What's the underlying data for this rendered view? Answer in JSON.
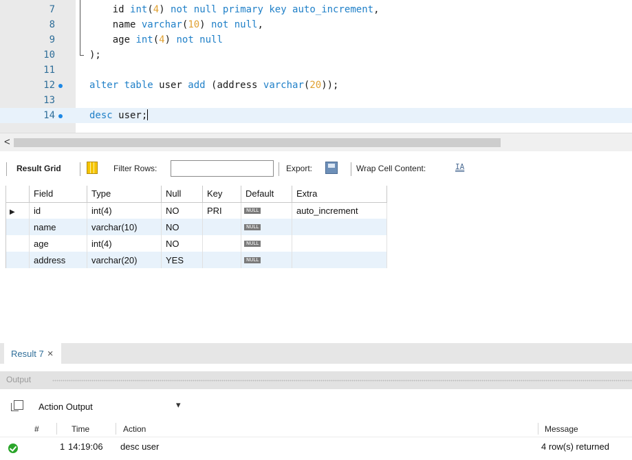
{
  "editor": {
    "lines": [
      {
        "num": "7",
        "marker": false,
        "current": false,
        "tokens": [
          {
            "t": "    id ",
            "c": ""
          },
          {
            "t": "int",
            "c": "kw"
          },
          {
            "t": "(",
            "c": ""
          },
          {
            "t": "4",
            "c": "nm"
          },
          {
            "t": ") ",
            "c": ""
          },
          {
            "t": "not null primary key auto_increment",
            "c": "kw"
          },
          {
            "t": ",",
            "c": ""
          }
        ]
      },
      {
        "num": "8",
        "marker": false,
        "current": false,
        "tokens": [
          {
            "t": "    name ",
            "c": ""
          },
          {
            "t": "varchar",
            "c": "kw"
          },
          {
            "t": "(",
            "c": ""
          },
          {
            "t": "10",
            "c": "nm"
          },
          {
            "t": ") ",
            "c": ""
          },
          {
            "t": "not null",
            "c": "kw"
          },
          {
            "t": ",",
            "c": ""
          }
        ]
      },
      {
        "num": "9",
        "marker": false,
        "current": false,
        "tokens": [
          {
            "t": "    age ",
            "c": ""
          },
          {
            "t": "int",
            "c": "kw"
          },
          {
            "t": "(",
            "c": ""
          },
          {
            "t": "4",
            "c": "nm"
          },
          {
            "t": ") ",
            "c": ""
          },
          {
            "t": "not null",
            "c": "kw"
          }
        ]
      },
      {
        "num": "10",
        "marker": false,
        "current": false,
        "tokens": [
          {
            "t": ");",
            "c": ""
          }
        ]
      },
      {
        "num": "11",
        "marker": false,
        "current": false,
        "tokens": []
      },
      {
        "num": "12",
        "marker": true,
        "current": false,
        "tokens": [
          {
            "t": "alter table",
            "c": "kw"
          },
          {
            "t": " user ",
            "c": ""
          },
          {
            "t": "add",
            "c": "kw"
          },
          {
            "t": " (address ",
            "c": ""
          },
          {
            "t": "varchar",
            "c": "kw"
          },
          {
            "t": "(",
            "c": ""
          },
          {
            "t": "20",
            "c": "nm"
          },
          {
            "t": "));",
            "c": ""
          }
        ]
      },
      {
        "num": "13",
        "marker": false,
        "current": false,
        "tokens": []
      },
      {
        "num": "14",
        "marker": true,
        "current": true,
        "tokens": [
          {
            "t": "desc",
            "c": "kw"
          },
          {
            "t": " user;",
            "c": ""
          }
        ]
      }
    ]
  },
  "scrollbar": {
    "left_arrow": "<"
  },
  "result_toolbar": {
    "result_grid_label": "Result Grid",
    "filter_rows_label": "Filter Rows:",
    "filter_value": "",
    "export_label": "Export:",
    "wrap_label": "Wrap Cell Content:",
    "wrap_icon": "IA"
  },
  "result_grid": {
    "columns": [
      "Field",
      "Type",
      "Null",
      "Key",
      "Default",
      "Extra"
    ],
    "rows": [
      {
        "field": "id",
        "type": "int(4)",
        "null": "NO",
        "key": "PRI",
        "default": "NULL",
        "extra": "auto_increment",
        "selected": true
      },
      {
        "field": "name",
        "type": "varchar(10)",
        "null": "NO",
        "key": "",
        "default": "NULL",
        "extra": "",
        "selected": false
      },
      {
        "field": "age",
        "type": "int(4)",
        "null": "NO",
        "key": "",
        "default": "NULL",
        "extra": "",
        "selected": false
      },
      {
        "field": "address",
        "type": "varchar(20)",
        "null": "YES",
        "key": "",
        "default": "NULL",
        "extra": "",
        "selected": false
      }
    ],
    "selected_marker": "▶"
  },
  "result_tab": {
    "label": "Result 7",
    "close": "×"
  },
  "output": {
    "title": "Output",
    "selector_value": "Action Output",
    "selector_caret": "▾",
    "headers": {
      "num": "#",
      "time": "Time",
      "action": "Action",
      "message": "Message"
    },
    "rows": [
      {
        "num": "1",
        "time": "14:19:06",
        "action": "desc user",
        "message": "4 row(s) returned",
        "status": "success"
      }
    ]
  },
  "colors": {
    "keyword": "#2080c8",
    "number": "#e0a030",
    "line_number": "#2f6e99",
    "current_line": "#e8f2fb",
    "marker": "#1e88e5",
    "success": "#2aa52a"
  }
}
